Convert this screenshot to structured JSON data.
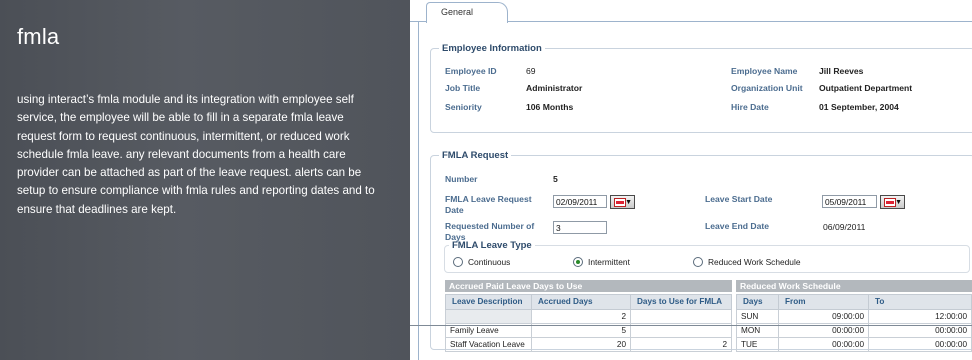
{
  "promo": {
    "title": "fmla",
    "body": "using interact’s fmla module and its integration with employee self service, the employee will be able to fill in a separate fmla leave request form to request continuous, intermittent, or reduced work schedule fmla leave.  any relevant documents from a health care provider can be attached as part of the leave request.  alerts can be setup to ensure compliance with fmla rules and reporting dates and to ensure that deadlines are kept."
  },
  "tabs": {
    "general": "General"
  },
  "employee": {
    "legend": "Employee Information",
    "id_label": "Employee ID",
    "id_value": "69",
    "name_label": "Employee Name",
    "name_value": "Jill Reeves",
    "job_label": "Job Title",
    "job_value": "Administrator",
    "org_label": "Organization Unit",
    "org_value": "Outpatient Department",
    "seniority_label": "Seniority",
    "seniority_value": "106 Months",
    "hire_label": "Hire Date",
    "hire_value": "01 September, 2004"
  },
  "request": {
    "legend": "FMLA Request",
    "number_label": "Number",
    "number_value": "5",
    "request_date_label": "FMLA Leave Request Date",
    "request_date_value": "02/09/2011",
    "leave_start_label": "Leave Start Date",
    "leave_start_value": "05/09/2011",
    "days_label": "Requested Number of Days",
    "days_value": "3",
    "leave_end_label": "Leave End Date",
    "leave_end_value": "06/09/2011",
    "type_legend": "FMLA Leave Type",
    "types": [
      "Continuous",
      "Intermittent",
      "Reduced Work Schedule"
    ],
    "selected_type": "Intermittent"
  },
  "accrued": {
    "title": "Accrued Paid Leave Days to Use",
    "columns": [
      "Leave Description",
      "Accrued Days",
      "Days to Use for FMLA"
    ],
    "rows": [
      [
        "",
        "2",
        ""
      ],
      [
        "Family Leave",
        "5",
        ""
      ],
      [
        "Staff Vacation Leave",
        "20",
        "2"
      ]
    ]
  },
  "schedule": {
    "title": "Reduced Work Schedule",
    "columns": [
      "Days",
      "From",
      "To"
    ],
    "rows": [
      [
        "SUN",
        "09:00:00",
        "12:00:00"
      ],
      [
        "MON",
        "00:00:00",
        "00:00:00"
      ],
      [
        "TUE",
        "00:00:00",
        "00:00:00"
      ]
    ]
  },
  "colors": {
    "promo_bg": "#52565d",
    "label": "#4b6c8f",
    "legend": "#2e4b6b",
    "grid_header": "#b3b8bd"
  }
}
